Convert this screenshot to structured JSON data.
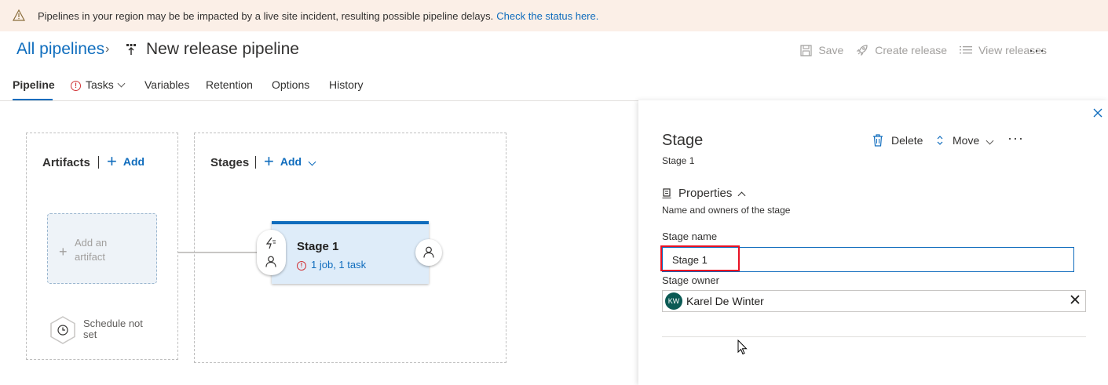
{
  "banner": {
    "message": "Pipelines in your region may be be impacted by a live site incident, resulting possible pipeline delays.",
    "link": "Check the status here."
  },
  "header": {
    "breadcrumb_root": "All pipelines",
    "title": "New release pipeline",
    "toolbar": {
      "save": "Save",
      "create_release": "Create release",
      "view_releases": "View releases"
    }
  },
  "tabs": [
    {
      "label": "Pipeline",
      "active": true
    },
    {
      "label": "Tasks",
      "has_error": true
    },
    {
      "label": "Variables"
    },
    {
      "label": "Retention"
    },
    {
      "label": "Options"
    },
    {
      "label": "History"
    }
  ],
  "canvas": {
    "artifacts": {
      "title": "Artifacts",
      "add_label": "Add",
      "placeholder": "Add an artifact",
      "schedule": "Schedule not set"
    },
    "stages": {
      "title": "Stages",
      "add_label": "Add",
      "stage": {
        "name": "Stage 1",
        "summary": "1 job, 1 task"
      }
    }
  },
  "panel": {
    "title": "Stage",
    "subtitle": "Stage 1",
    "actions": {
      "delete": "Delete",
      "move": "Move"
    },
    "properties": {
      "title": "Properties",
      "description": "Name and owners of the stage"
    },
    "stage_name_label": "Stage name",
    "stage_name_value": "Stage 1",
    "stage_owner_label": "Stage owner",
    "owner": {
      "initials": "KW",
      "name": "Karel De Winter"
    }
  },
  "colors": {
    "accent": "#0f6cbd",
    "banner_bg": "#fbefe7",
    "error": "#d13438",
    "highlight": "#e81123",
    "avatar": "#0b5a54"
  }
}
